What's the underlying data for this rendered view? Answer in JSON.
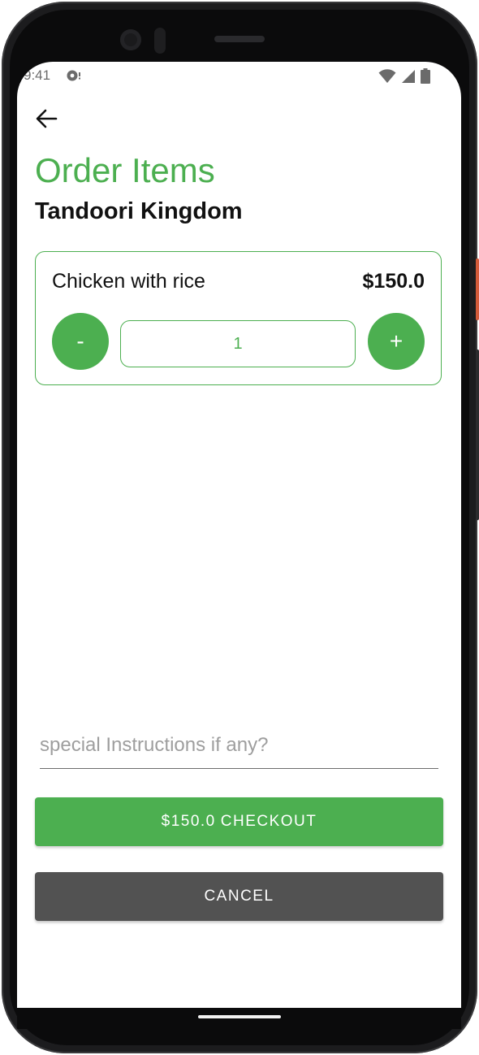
{
  "status_bar": {
    "time": "9:41",
    "icons": [
      "notification-icon",
      "wifi-icon",
      "cellular-icon",
      "battery-icon"
    ]
  },
  "header": {
    "back_icon": "arrow-back-icon",
    "title": "Order Items",
    "subtitle": "Tandoori Kingdom"
  },
  "cart": {
    "items": [
      {
        "name": "Chicken with rice",
        "price": "$150.0",
        "quantity": "1",
        "decrement_label": "-",
        "increment_label": "+"
      }
    ]
  },
  "form": {
    "instructions_placeholder": "special Instructions if any?",
    "instructions_value": ""
  },
  "actions": {
    "checkout_price": "$150.0",
    "checkout_label": "CHECKOUT",
    "cancel_label": "CANCEL"
  },
  "colors": {
    "accent": "#4caf50",
    "cancel_bg": "#525252",
    "text": "#111111"
  }
}
